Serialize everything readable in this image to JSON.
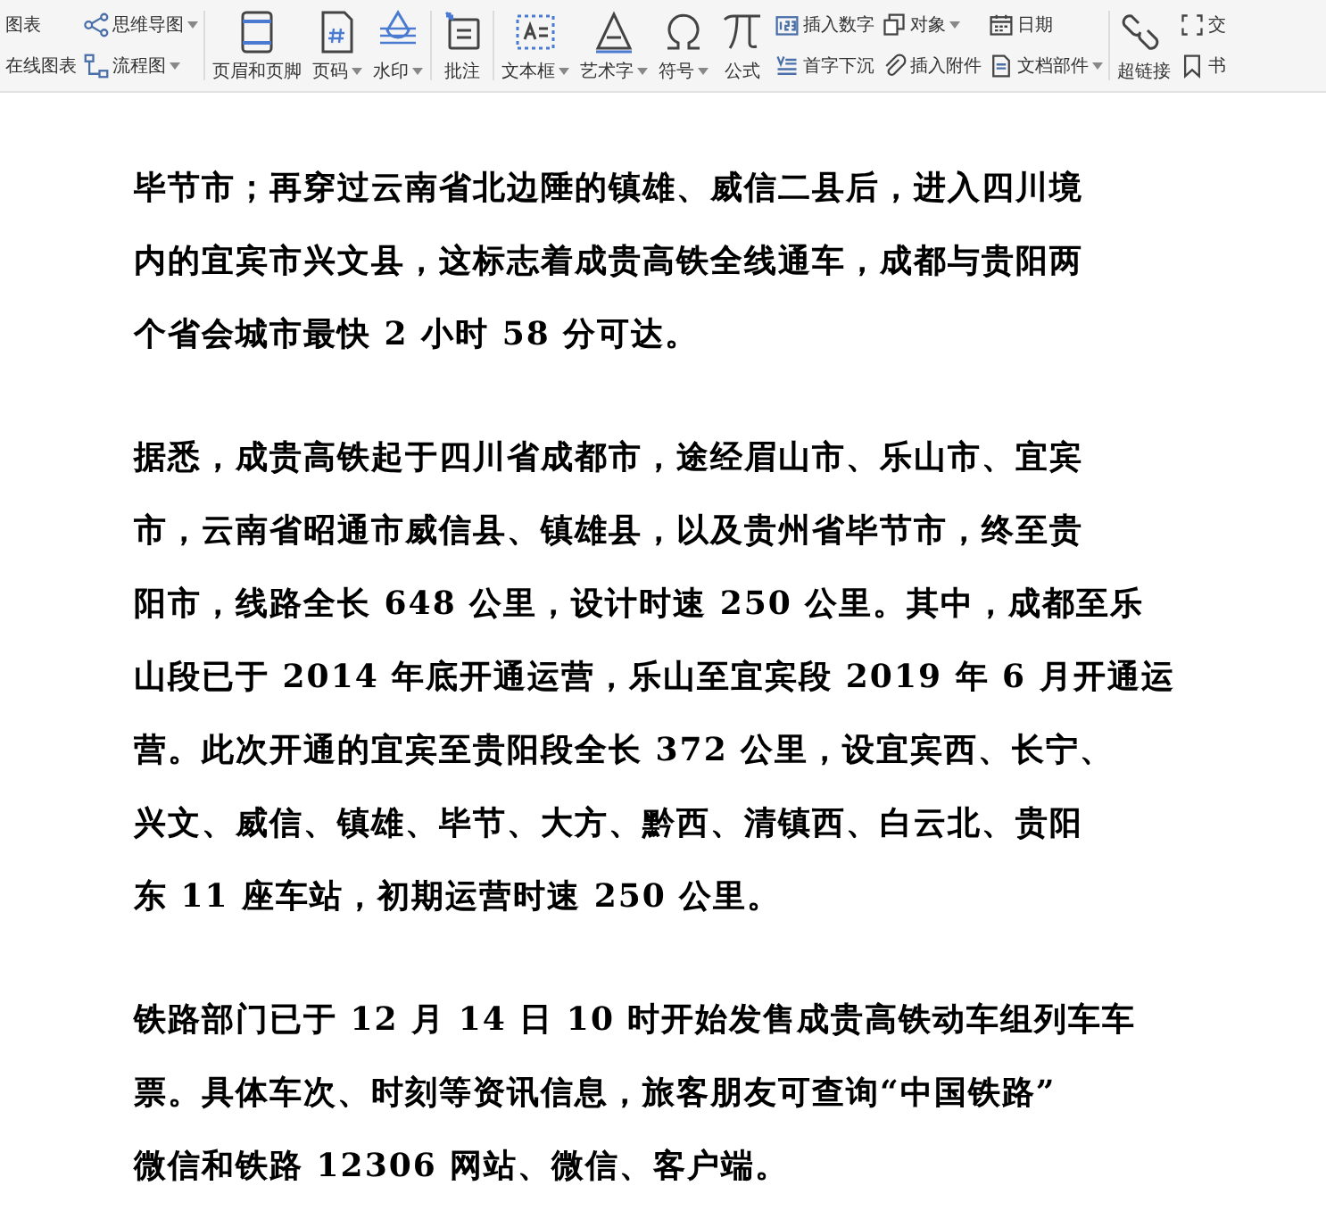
{
  "toolbar": {
    "groups": [
      {
        "items": [
          {
            "kind": "stack",
            "items": [
              {
                "label": "图表",
                "dropdown": false
              },
              {
                "label": "在线图表",
                "dropdown": false
              }
            ]
          },
          {
            "kind": "stack",
            "items": [
              {
                "label": "思维导图",
                "dropdown": true
              },
              {
                "label": "流程图",
                "dropdown": true
              }
            ]
          }
        ]
      },
      {
        "items": [
          {
            "kind": "large",
            "label": "页眉和页脚",
            "dropdown": false
          },
          {
            "kind": "large",
            "label": "页码",
            "dropdown": true
          },
          {
            "kind": "large",
            "label": "水印",
            "dropdown": true
          }
        ]
      },
      {
        "items": [
          {
            "kind": "large",
            "label": "批注",
            "dropdown": false
          }
        ]
      },
      {
        "items": [
          {
            "kind": "large",
            "label": "文本框",
            "dropdown": true
          },
          {
            "kind": "large",
            "label": "艺术字",
            "dropdown": true
          },
          {
            "kind": "large",
            "label": "符号",
            "dropdown": true
          },
          {
            "kind": "large",
            "label": "公式",
            "dropdown": false
          },
          {
            "kind": "stack",
            "items": [
              {
                "label": "插入数字",
                "dropdown": false
              },
              {
                "label": "首字下沉",
                "dropdown": false
              }
            ]
          },
          {
            "kind": "stack",
            "items": [
              {
                "label": "对象",
                "dropdown": true
              },
              {
                "label": "插入附件",
                "dropdown": false
              }
            ]
          },
          {
            "kind": "stack",
            "items": [
              {
                "label": "日期",
                "dropdown": false
              },
              {
                "label": "文档部件",
                "dropdown": true
              }
            ]
          }
        ]
      },
      {
        "items": [
          {
            "kind": "large",
            "label": "超链接",
            "dropdown": false
          },
          {
            "kind": "stack",
            "items": [
              {
                "label": "交",
                "dropdown": false
              },
              {
                "label": "书",
                "dropdown": false
              }
            ]
          }
        ]
      }
    ]
  },
  "document": {
    "paragraphs": [
      {
        "lines": [
          "毕节市；再穿过云南省北边陲的镇雄、威信二县后，进入四川境",
          "内的宜宾市兴文县，这标志着成贵高铁全线通车，成都与贵阳两",
          "个省会城市最快 2 小时 58 分可达。"
        ]
      },
      {
        "lines": [
          "据悉，成贵高铁起于四川省成都市，途经眉山市、乐山市、宜宾",
          "市，云南省昭通市威信县、镇雄县，以及贵州省毕节市，终至贵",
          "阳市，线路全长 648 公里，设计时速 250 公里。其中，成都至乐",
          "山段已于 2014 年底开通运营，乐山至宜宾段 2019 年 6 月开通运",
          "营。此次开通的宜宾至贵阳段全长 372 公里，设宜宾西、长宁、",
          "兴文、威信、镇雄、毕节、大方、黔西、清镇西、白云北、贵阳",
          "东 11 座车站，初期运营时速 250 公里。"
        ]
      },
      {
        "lines": [
          "铁路部门已于 12 月 14 日 10 时开始发售成贵高铁动车组列车车",
          "票。具体车次、时刻等资讯信息，旅客朋友可查询“中国铁路”",
          "微信和铁路 12306 网站、微信、客户端。"
        ]
      }
    ]
  }
}
